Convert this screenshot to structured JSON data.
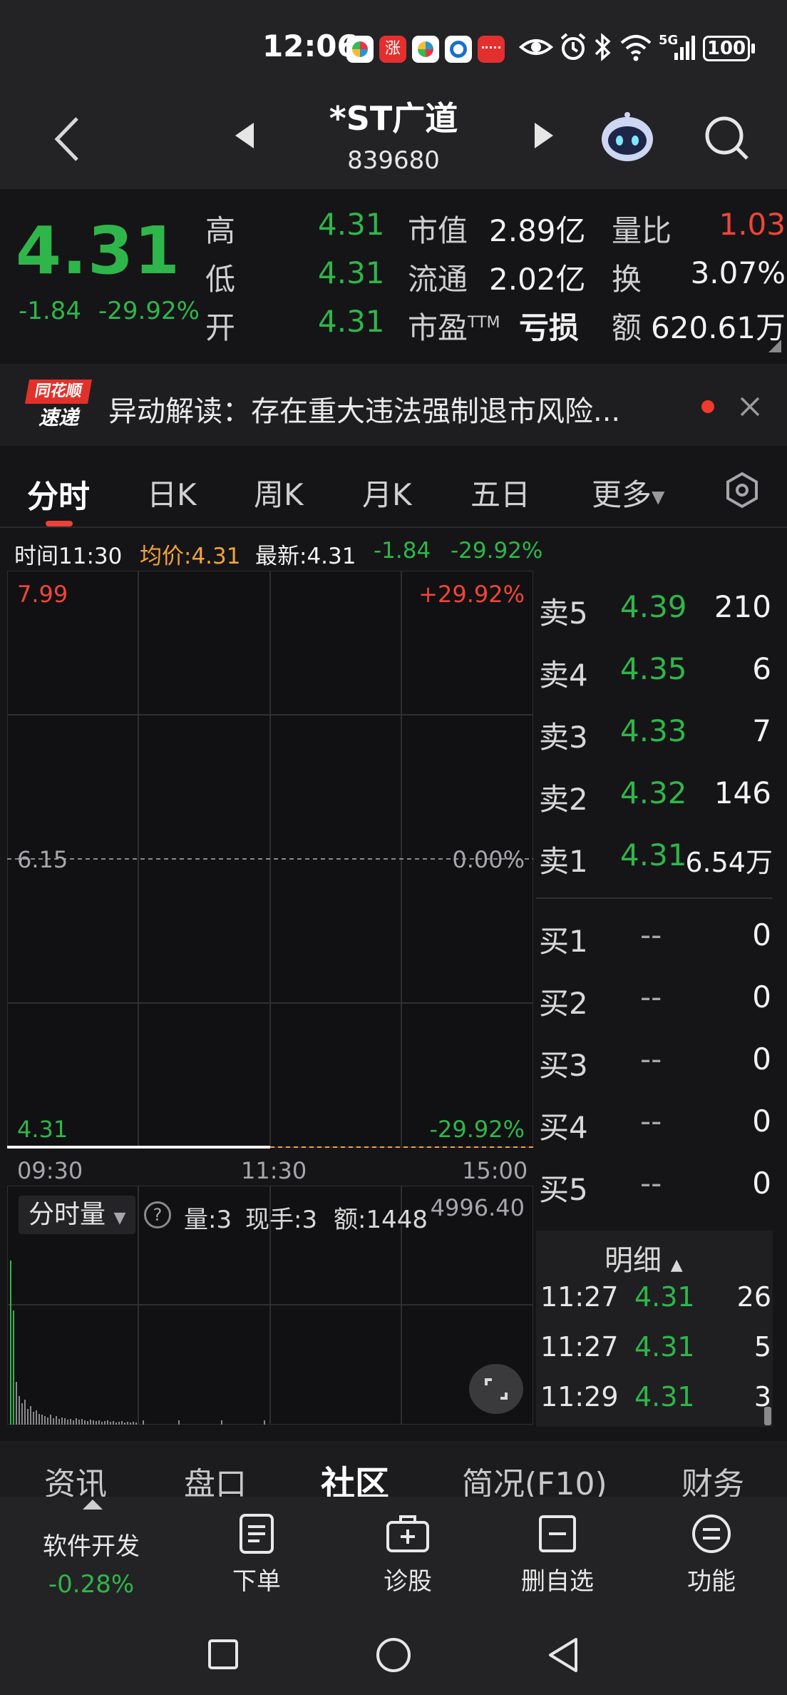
{
  "status": {
    "time": "12:06",
    "network": "5G",
    "battery": "100"
  },
  "header": {
    "title": "*ST广道",
    "code": "839680"
  },
  "quote": {
    "price": "4.31",
    "change": "-1.84",
    "change_pct": "-29.92%",
    "high_label": "高",
    "high": "4.31",
    "low_label": "低",
    "low": "4.31",
    "open_label": "开",
    "open": "4.31",
    "mcap_label": "市值",
    "mcap": "2.89亿",
    "float_label": "流通",
    "float": "2.02亿",
    "pe_label": "市盈",
    "pe_sup": "TTM",
    "pe": "亏损",
    "vr_label": "量比",
    "vr": "1.03",
    "turn_label": "换",
    "turn": "3.07%",
    "amt_label": "额",
    "amt": "620.61万"
  },
  "news": {
    "logo_top": "同花顺",
    "logo_bottom": "速递",
    "text": "异动解读：存在重大违法强制退市风险..."
  },
  "tabs": [
    "分时",
    "日K",
    "周K",
    "月K",
    "五日",
    "更多"
  ],
  "inforow": {
    "time": "时间11:30",
    "avg": "均价:4.31",
    "latest": "最新:4.31",
    "chg": "-1.84",
    "pct": "-29.92%"
  },
  "chart": {
    "top_price": "7.99",
    "top_pct": "+29.92%",
    "mid_price": "6.15",
    "mid_pct": "0.00%",
    "bot_price": "4.31",
    "bot_pct": "-29.92%",
    "x_start": "09:30",
    "x_mid": "11:30",
    "x_end": "15:00"
  },
  "volume": {
    "selector": "分时量",
    "help": "?",
    "vol": "量:3",
    "hand": "现手:3",
    "amount": "额:1448",
    "max": "4996.40"
  },
  "orderbook": {
    "asks": [
      {
        "label": "卖5",
        "price": "4.39",
        "qty": "210"
      },
      {
        "label": "卖4",
        "price": "4.35",
        "qty": "6"
      },
      {
        "label": "卖3",
        "price": "4.33",
        "qty": "7"
      },
      {
        "label": "卖2",
        "price": "4.32",
        "qty": "146"
      },
      {
        "label": "卖1",
        "price": "4.31",
        "qty": "6.54万"
      }
    ],
    "bids": [
      {
        "label": "买1",
        "price": "--",
        "qty": "0"
      },
      {
        "label": "买2",
        "price": "--",
        "qty": "0"
      },
      {
        "label": "买3",
        "price": "--",
        "qty": "0"
      },
      {
        "label": "买4",
        "price": "--",
        "qty": "0"
      },
      {
        "label": "买5",
        "price": "--",
        "qty": "0"
      }
    ]
  },
  "detail": {
    "title": "明细",
    "rows": [
      {
        "time": "11:27",
        "price": "4.31",
        "qty": "26"
      },
      {
        "time": "11:27",
        "price": "4.31",
        "qty": "5"
      },
      {
        "time": "11:29",
        "price": "4.31",
        "qty": "3"
      }
    ]
  },
  "bottom_tabs": [
    "资讯",
    "盘口",
    "社区",
    "简况(F10)",
    "财务"
  ],
  "toolbar": {
    "sector": "软件开发",
    "sector_pct": "-0.28%",
    "order": "下单",
    "diagnose": "诊股",
    "remove": "删自选",
    "func": "功能"
  },
  "colors": {
    "up": "#f04538",
    "down": "#2fb64a",
    "avg": "#f2a33a",
    "bg": "#151517"
  }
}
